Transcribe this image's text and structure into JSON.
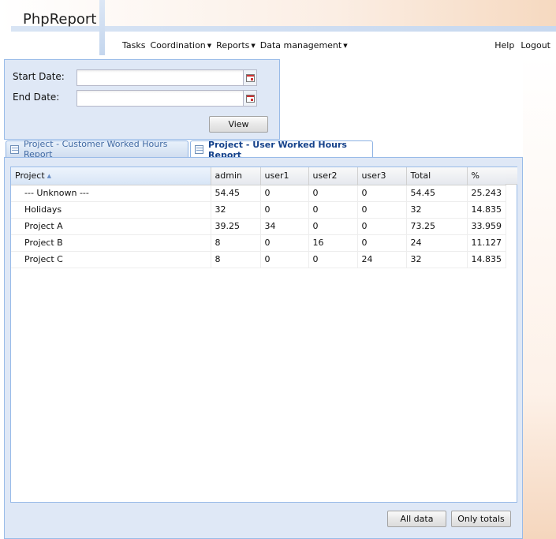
{
  "app": {
    "title": "PhpReport"
  },
  "menu": {
    "items": [
      {
        "label": "Tasks",
        "dropdown": false
      },
      {
        "label": "Coordination",
        "dropdown": true
      },
      {
        "label": "Reports",
        "dropdown": true
      },
      {
        "label": "Data management",
        "dropdown": true
      }
    ],
    "help": "Help",
    "logout": "Logout"
  },
  "filter": {
    "start_label": "Start Date:",
    "start_value": "",
    "end_label": "End Date:",
    "end_value": "",
    "view_button": "View"
  },
  "tabs": [
    {
      "label": "Project - Customer Worked Hours Report",
      "active": false
    },
    {
      "label": "Project - User Worked Hours Report",
      "active": true
    }
  ],
  "grid": {
    "columns": [
      "Project",
      "admin",
      "user1",
      "user2",
      "user3",
      "Total",
      "%"
    ],
    "sorted_column": "Project",
    "sort_direction": "asc",
    "rows": [
      [
        "--- Unknown ---",
        "54.45",
        "0",
        "0",
        "0",
        "54.45",
        "25.243"
      ],
      [
        "Holidays",
        "32",
        "0",
        "0",
        "0",
        "32",
        "14.835"
      ],
      [
        "Project A",
        "39.25",
        "34",
        "0",
        "0",
        "73.25",
        "33.959"
      ],
      [
        "Project B",
        "8",
        "0",
        "16",
        "0",
        "24",
        "11.127"
      ],
      [
        "Project C",
        "8",
        "0",
        "0",
        "24",
        "32",
        "14.835"
      ]
    ]
  },
  "footer": {
    "all_data_button": "All data",
    "only_totals_button": "Only totals"
  }
}
